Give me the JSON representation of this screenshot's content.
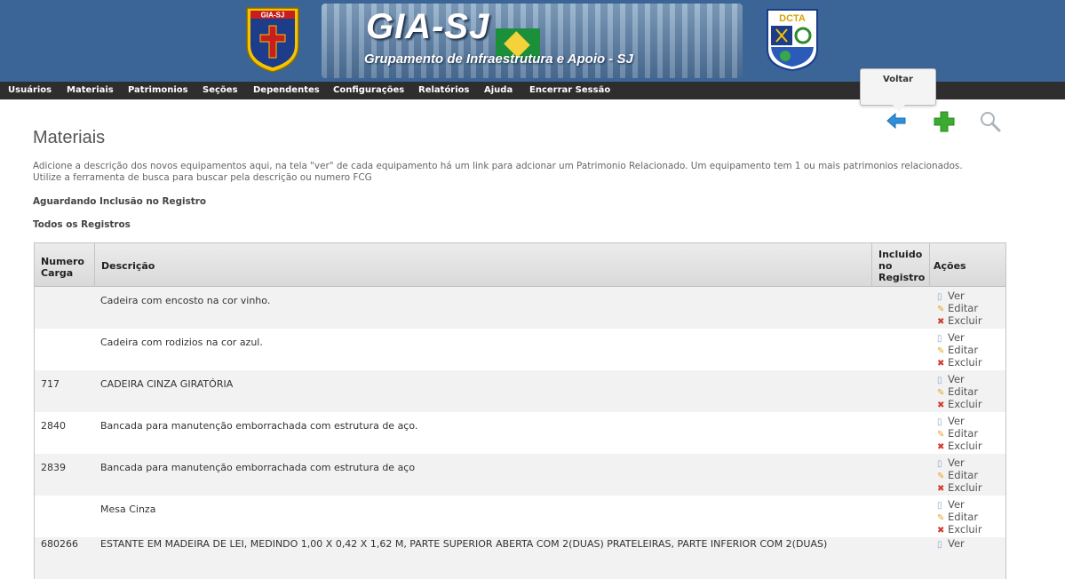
{
  "header": {
    "left_emblem_text": "GIA-SJ",
    "banner_title": "GIA-SJ",
    "banner_subtitle": "Grupamento de Infraestrutura e Apoio - SJ",
    "right_emblem_text": "DCTA"
  },
  "nav": {
    "items": [
      "Usuários",
      "Materiais",
      "Patrimonios",
      "Seções",
      "Dependentes",
      "Configurações",
      "Relatórios",
      "Ajuda",
      "Encerrar Sessão"
    ]
  },
  "tooltip": "Voltar",
  "toolbar": {
    "back_icon": "arrow-left-icon",
    "add_icon": "plus-icon",
    "search_icon": "magnifier-icon"
  },
  "page": {
    "title": "Materiais",
    "description_line1": "Adicione a descrição dos novos equipamentos aqui, na tela \"ver\" de cada equipamento há um link para adcionar um Patrimonio Relacionado. Um equipamento tem 1 ou mais patrimonios relacionados.",
    "description_line2": "Utilize a ferramenta de busca para buscar pela descrição ou numero FCG",
    "pending_label": "Aguardando Inclusão no Registro",
    "all_label": "Todos os Registros"
  },
  "table": {
    "headers": {
      "numero_line1": "Numero",
      "numero_line2": "Carga",
      "descricao": "Descrição",
      "incluido_line1": "Incluido",
      "incluido_line2": "no",
      "incluido_line3": "Registro",
      "acoes": "Ações"
    },
    "action_labels": {
      "view": "Ver",
      "edit": "Editar",
      "delete": "Excluir"
    },
    "rows": [
      {
        "numero": "",
        "descricao": "Cadeira com encosto na cor vinho."
      },
      {
        "numero": "",
        "descricao": "Cadeira com rodizios na cor azul."
      },
      {
        "numero": "717",
        "descricao": "CADEIRA CINZA GIRATÓRIA"
      },
      {
        "numero": "2840",
        "descricao": "Bancada para manutenção emborrachada com estrutura de aço."
      },
      {
        "numero": "2839",
        "descricao": "Bancada para manutenção emborrachada com estrutura de aço"
      },
      {
        "numero": "",
        "descricao": "Mesa Cinza"
      },
      {
        "numero": "680266",
        "descricao": "ESTANTE EM MADEIRA DE LEI, MEDINDO 1,00 X 0,42 X 1,62 M, PARTE SUPERIOR ABERTA COM 2(DUAS) PRATELEIRAS, PARTE INFERIOR COM 2(DUAS)"
      }
    ]
  },
  "colors": {
    "header_bg": "#3a6596",
    "nav_bg": "#2e2e2e",
    "row_alt": "#f2f2f2",
    "add_green": "#3bab2f",
    "back_blue": "#2f8fd8"
  }
}
